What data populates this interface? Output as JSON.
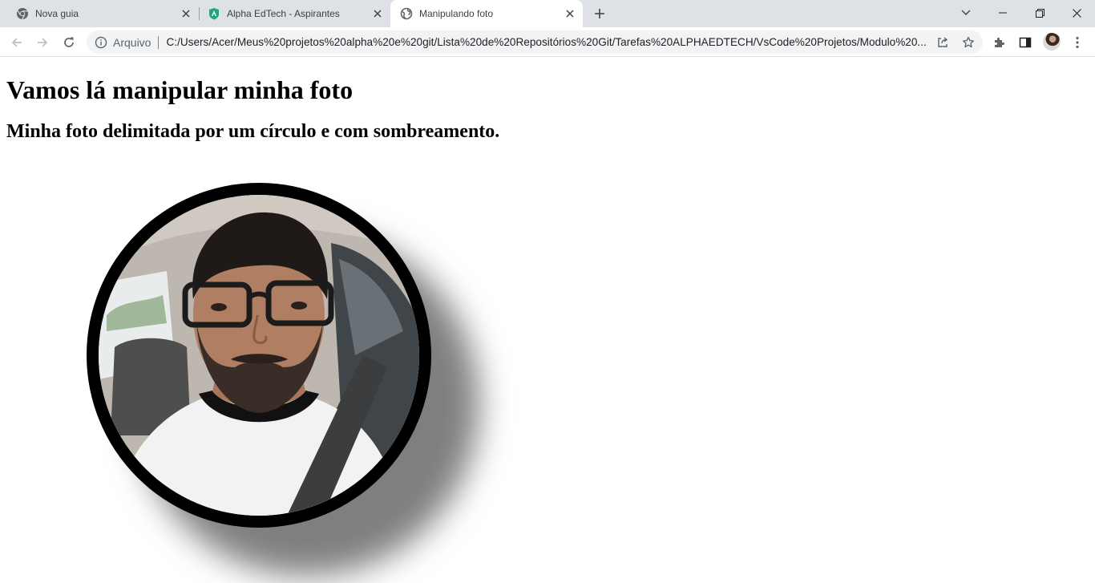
{
  "browser": {
    "tabs": [
      {
        "title": "Nova guia",
        "icon": "chrome-icon",
        "active": false
      },
      {
        "title": "Alpha EdTech - Aspirantes",
        "icon": "alpha-edtech-icon",
        "active": false
      },
      {
        "title": "Manipulando foto",
        "icon": "globe-icon",
        "active": true
      }
    ],
    "omnibox": {
      "scheme_label": "Arquivo",
      "url": "C:/Users/Acer/Meus%20projetos%20alpha%20e%20git/Lista%20de%20Repositórios%20Git/Tarefas%20ALPHAEDTECH/VsCode%20Projetos/Modulo%20..."
    }
  },
  "page": {
    "heading": "Vamos lá manipular minha foto",
    "subheading": "Minha foto delimitada por um círculo e com sombreamento."
  }
}
